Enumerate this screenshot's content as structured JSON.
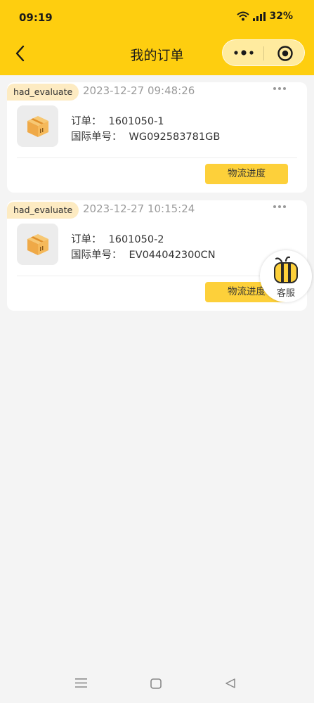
{
  "status_bar": {
    "time": "09:19",
    "battery": "32%"
  },
  "header": {
    "title": "我的订单"
  },
  "orders": [
    {
      "tag": "had_evaluate",
      "timestamp": "2023-12-27 09:48:26",
      "order_label": "订单：",
      "order_value": "1601050-1",
      "intl_label": "国际单号：",
      "intl_value": "WG092583781GB",
      "button": "物流进度"
    },
    {
      "tag": "had_evaluate",
      "timestamp": "2023-12-27 10:15:24",
      "order_label": "订单：",
      "order_value": "1601050-2",
      "intl_label": "国际单号：",
      "intl_value": "EV044042300CN",
      "button": "物流进度"
    }
  ],
  "customer_service": {
    "label": "客服",
    "icon": "bee-icon"
  },
  "colors": {
    "header": "#fece0f",
    "button": "#fdd03a",
    "tag_bg": "#fdebc2",
    "background": "#f4f4f4"
  }
}
